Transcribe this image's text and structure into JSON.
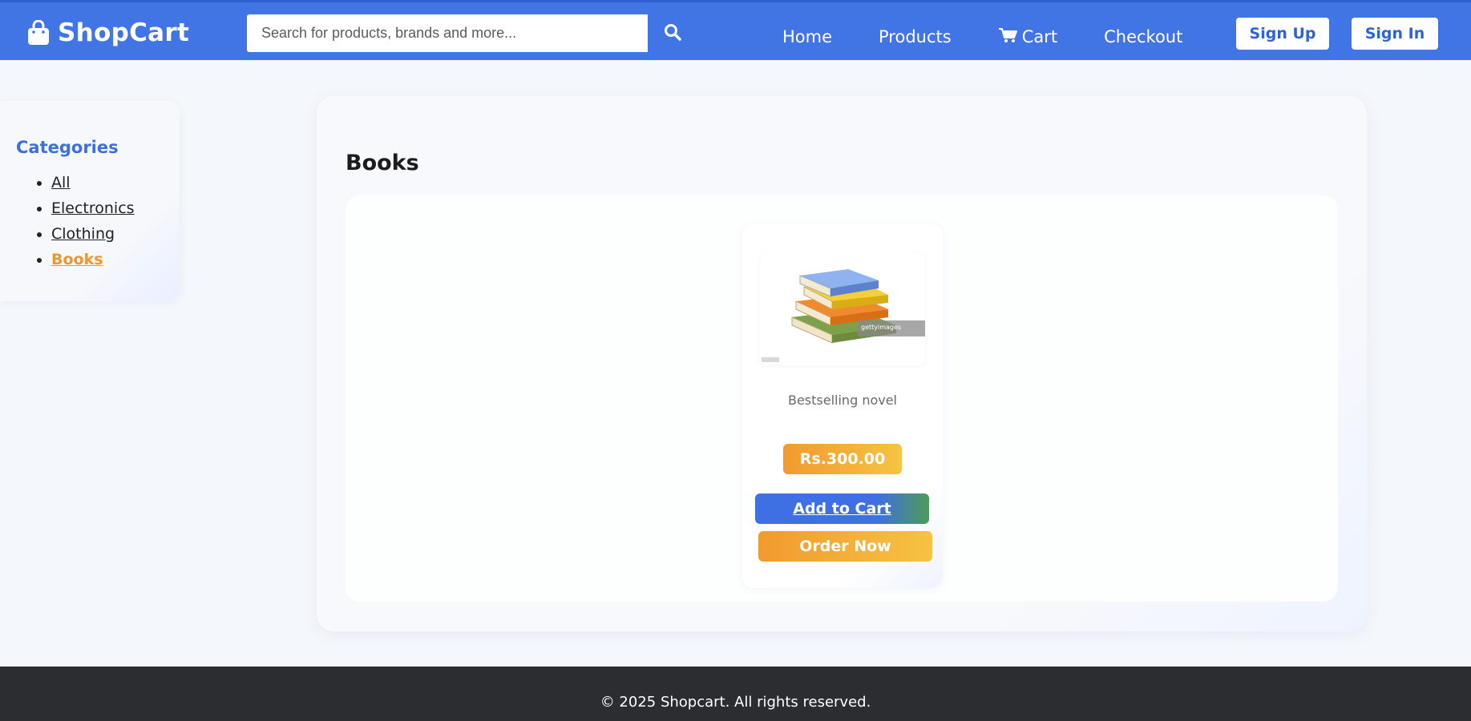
{
  "header": {
    "brand": "ShopCart",
    "search": {
      "placeholder": "Search for products, brands and more..."
    },
    "nav": [
      {
        "label": "Home"
      },
      {
        "label": "Products"
      },
      {
        "label": "Cart",
        "icon": "cart-icon"
      },
      {
        "label": "Checkout"
      }
    ],
    "sign_up": "Sign Up",
    "sign_in": "Sign In"
  },
  "sidebar": {
    "title": "Categories",
    "items": [
      {
        "label": "All",
        "active": false
      },
      {
        "label": "Electronics",
        "active": false
      },
      {
        "label": "Clothing",
        "active": false
      },
      {
        "label": "Books",
        "active": true
      }
    ]
  },
  "main": {
    "title": "Books",
    "products": [
      {
        "image_watermark": "gettyimages",
        "description": "Bestselling novel",
        "price": "Rs.300.00",
        "add_to_cart": "Add to Cart",
        "order_now": "Order Now"
      }
    ]
  },
  "footer": {
    "text": "© 2025 Shopcart. All rights reserved."
  },
  "colors": {
    "header_bg": "#4175e6",
    "accent_orange": "#f0962d",
    "footer_bg": "#2b2d31",
    "category_title": "#3c70dd"
  }
}
